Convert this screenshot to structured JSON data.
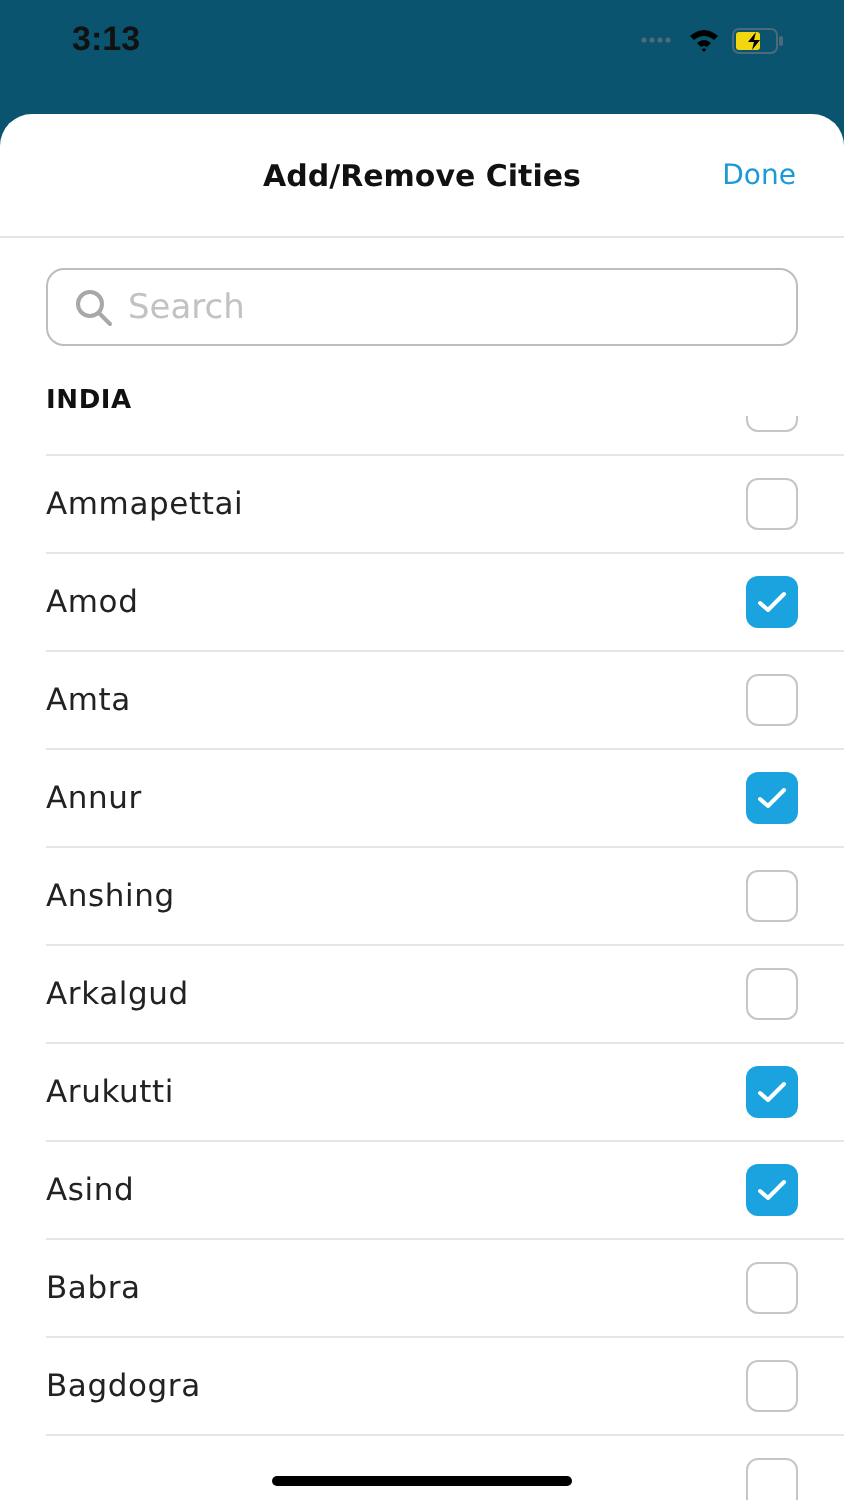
{
  "status_bar": {
    "time": "3:13"
  },
  "sheet": {
    "title": "Add/Remove Cities",
    "done": "Done"
  },
  "search": {
    "placeholder": "Search"
  },
  "section": "INDIA",
  "row_above": {
    "checked": false
  },
  "cities": [
    {
      "name": "Ammapettai",
      "checked": false
    },
    {
      "name": "Amod",
      "checked": true
    },
    {
      "name": "Amta",
      "checked": false
    },
    {
      "name": "Annur",
      "checked": true
    },
    {
      "name": "Anshing",
      "checked": false
    },
    {
      "name": "Arkalgud",
      "checked": false
    },
    {
      "name": "Arukutti",
      "checked": true
    },
    {
      "name": "Asind",
      "checked": true
    },
    {
      "name": "Babra",
      "checked": false
    },
    {
      "name": "Bagdogra",
      "checked": false
    }
  ],
  "row_below": {
    "checked": false
  }
}
